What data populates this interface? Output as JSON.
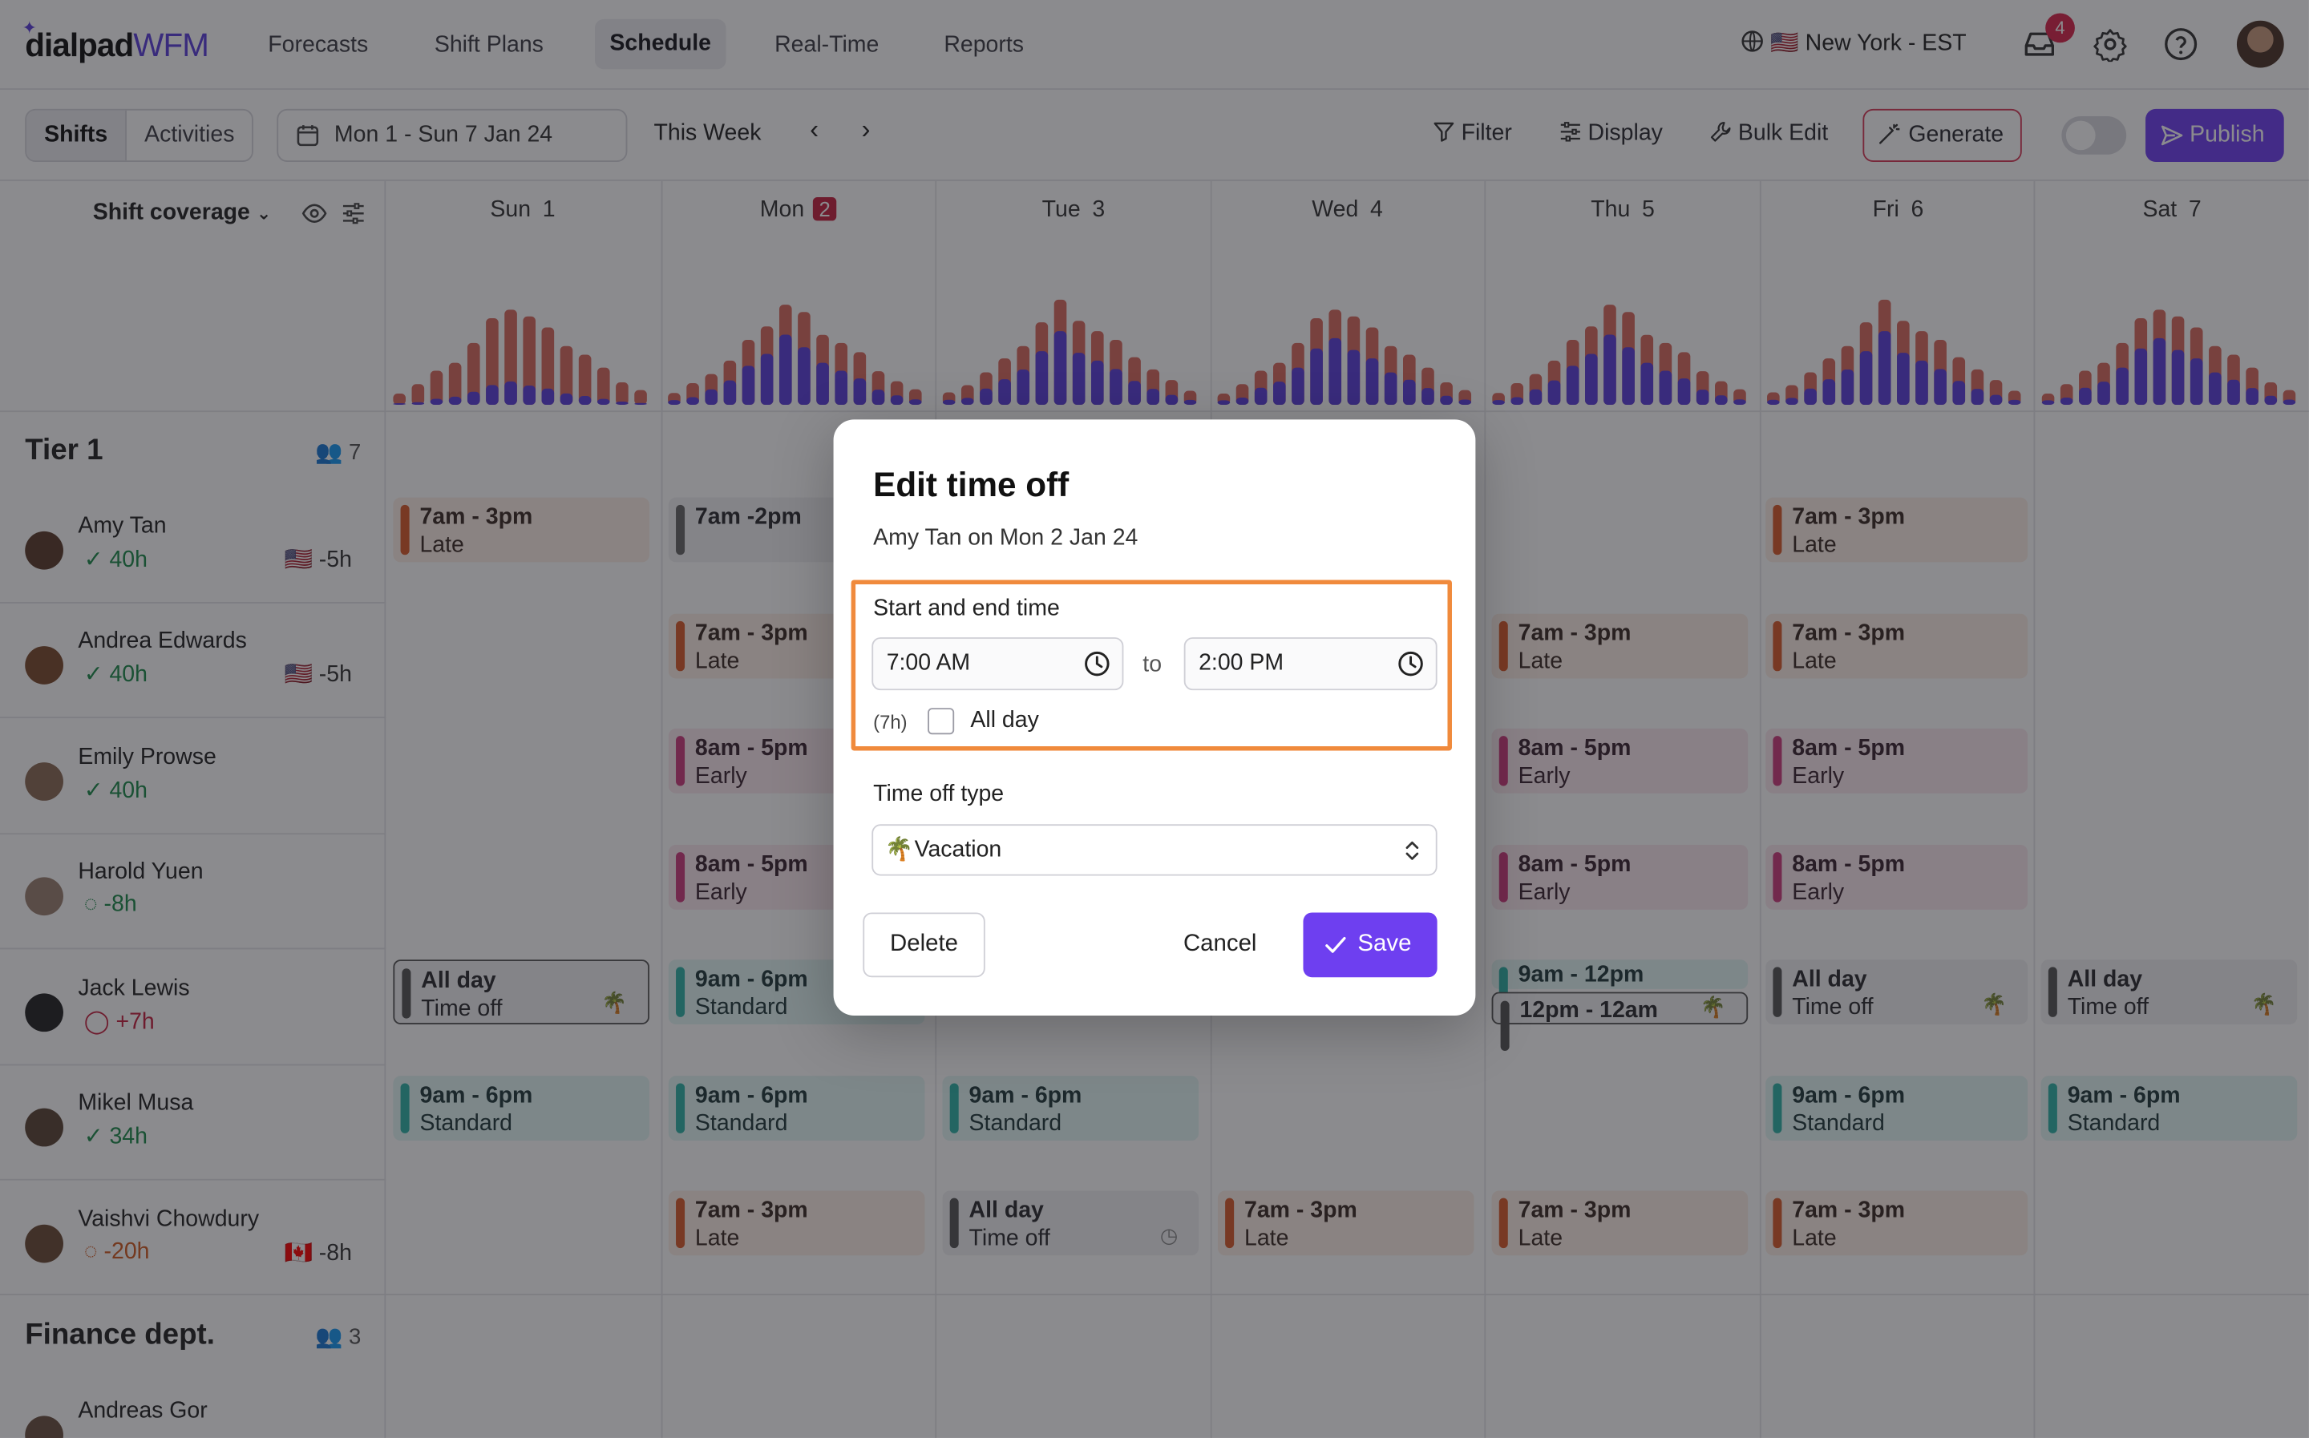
{
  "nav": {
    "brand": "dialpad",
    "product": "WFM",
    "items": [
      {
        "label": "Forecasts",
        "active": false
      },
      {
        "label": "Shift Plans",
        "active": false
      },
      {
        "label": "Schedule",
        "active": true
      },
      {
        "label": "Real-Time",
        "active": false
      },
      {
        "label": "Reports",
        "active": false
      }
    ],
    "timezone": "New York - EST",
    "inbox_count": "4",
    "icons": [
      "globe-icon",
      "inbox-icon",
      "gear-icon",
      "help-icon",
      "user-avatar"
    ]
  },
  "toolbar": {
    "view_tabs": [
      "Shifts",
      "Activities"
    ],
    "active_tab": "Shifts",
    "date_range": "Mon 1 - Sun 7 Jan 24",
    "period_label": "This Week",
    "filter_label": "Filter",
    "display_label": "Display",
    "bulk_edit_label": "Bulk Edit",
    "generate_label": "Generate",
    "publish_label": "Publish"
  },
  "coverage": {
    "label": "Shift coverage",
    "colors": {
      "required": "#d96a5f",
      "scheduled": "#5b3fdb"
    }
  },
  "days": [
    {
      "name": "Sun",
      "num": "1"
    },
    {
      "name": "Mon",
      "num": "2",
      "today": true
    },
    {
      "name": "Tue",
      "num": "3"
    },
    {
      "name": "Wed",
      "num": "4"
    },
    {
      "name": "Thu",
      "num": "5"
    },
    {
      "name": "Fri",
      "num": "6"
    },
    {
      "name": "Sat",
      "num": "7"
    }
  ],
  "groups": [
    {
      "name": "Tier 1",
      "count": "7"
    },
    {
      "name": "Finance dept.",
      "count": "3"
    }
  ],
  "people": [
    {
      "name": "Amy Tan",
      "hours": "✓ 40h",
      "offset": "🇺🇸 -5h"
    },
    {
      "name": "Andrea Edwards",
      "hours": "✓ 40h",
      "offset": "🇺🇸 -5h"
    },
    {
      "name": "Emily Prowse",
      "hours": "✓ 40h",
      "offset": ""
    },
    {
      "name": "Harold Yuen",
      "hours": "◌ -8h",
      "offset": ""
    },
    {
      "name": "Jack Lewis",
      "hours": "◯ +7h",
      "offset": ""
    },
    {
      "name": "Mikel Musa",
      "hours": "✓ 34h",
      "offset": ""
    },
    {
      "name": "Vaishvi Chowdury",
      "hours": "◌ -20h",
      "offset": "🇨🇦 -8h"
    },
    {
      "name": "Andreas Gor",
      "hours": "",
      "offset": ""
    }
  ],
  "shift_text": {
    "late": [
      "7am - 3pm",
      "Late"
    ],
    "late_alt": [
      "7am -2pm",
      ""
    ],
    "early": [
      "8am - 5pm",
      "Early"
    ],
    "standard": [
      "9am - 6pm",
      "Standard"
    ],
    "timeoff": [
      "All day",
      "Time off"
    ],
    "split_a": "9am - 12pm",
    "split_b": "12pm - 12am"
  },
  "modal": {
    "title": "Edit time off",
    "subtitle": "Amy Tan on Mon 2 Jan 24",
    "time_label": "Start and end time",
    "start_time": "7:00 AM",
    "to_label": "to",
    "end_time": "2:00 PM",
    "duration": "(7h)",
    "all_day_label": "All day",
    "all_day_checked": false,
    "type_label": "Time off type",
    "type_value": "Vacation",
    "type_icon": "palm-tree-icon",
    "delete_label": "Delete",
    "cancel_label": "Cancel",
    "save_label": "Save",
    "highlight_color": "#f08a3c",
    "primary_color": "#6e3ff0"
  }
}
